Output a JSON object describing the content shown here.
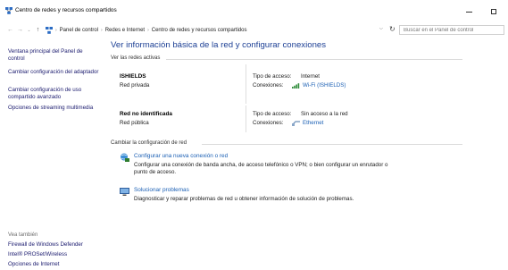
{
  "window": {
    "title": "Centro de redes y recursos compartidos",
    "icon": "network-center-icon"
  },
  "addressbar": {
    "breadcrumbs": [
      "Panel de control",
      "Redes e Internet",
      "Centro de redes y recursos compartidos"
    ],
    "search_placeholder": "Buscar en el Panel de control"
  },
  "sidebar": {
    "links": [
      "Ventana principal del Panel de control",
      "Cambiar configuración del adaptador",
      "Cambiar configuración de uso compartido avanzado",
      "Opciones de streaming multimedia"
    ],
    "see_also_label": "Vea también",
    "see_also": [
      "Firewall de Windows Defender",
      "Intel® PROSet/Wireless",
      "Opciones de Internet"
    ]
  },
  "main": {
    "title": "Ver información básica de la red y configurar conexiones",
    "active_networks_label": "Ver las redes activas",
    "networks": [
      {
        "name": "ISHIELDS",
        "type": "Red privada",
        "access_label": "Tipo de acceso:",
        "access_value": "Internet",
        "connections_label": "Conexiones:",
        "connection": "Wi-Fi (ISHIELDS)",
        "connection_icon": "wifi-signal-icon"
      },
      {
        "name": "Red no identificada",
        "type": "Red pública",
        "access_label": "Tipo de acceso:",
        "access_value": "Sin acceso a la red",
        "connections_label": "Conexiones:",
        "connection": "Ethernet",
        "connection_icon": "ethernet-icon"
      }
    ],
    "change_settings_label": "Cambiar la configuración de red",
    "tasks": [
      {
        "link": "Configurar una nueva conexión o red",
        "description": "Configurar una conexión de banda ancha, de acceso telefónico o VPN; o bien configurar un enrutador o punto de acceso.",
        "icon": "new-connection-icon"
      },
      {
        "link": "Solucionar problemas",
        "description": "Diagnosticar y reparar problemas de red u obtener información de solución de problemas.",
        "icon": "troubleshoot-icon"
      }
    ]
  }
}
